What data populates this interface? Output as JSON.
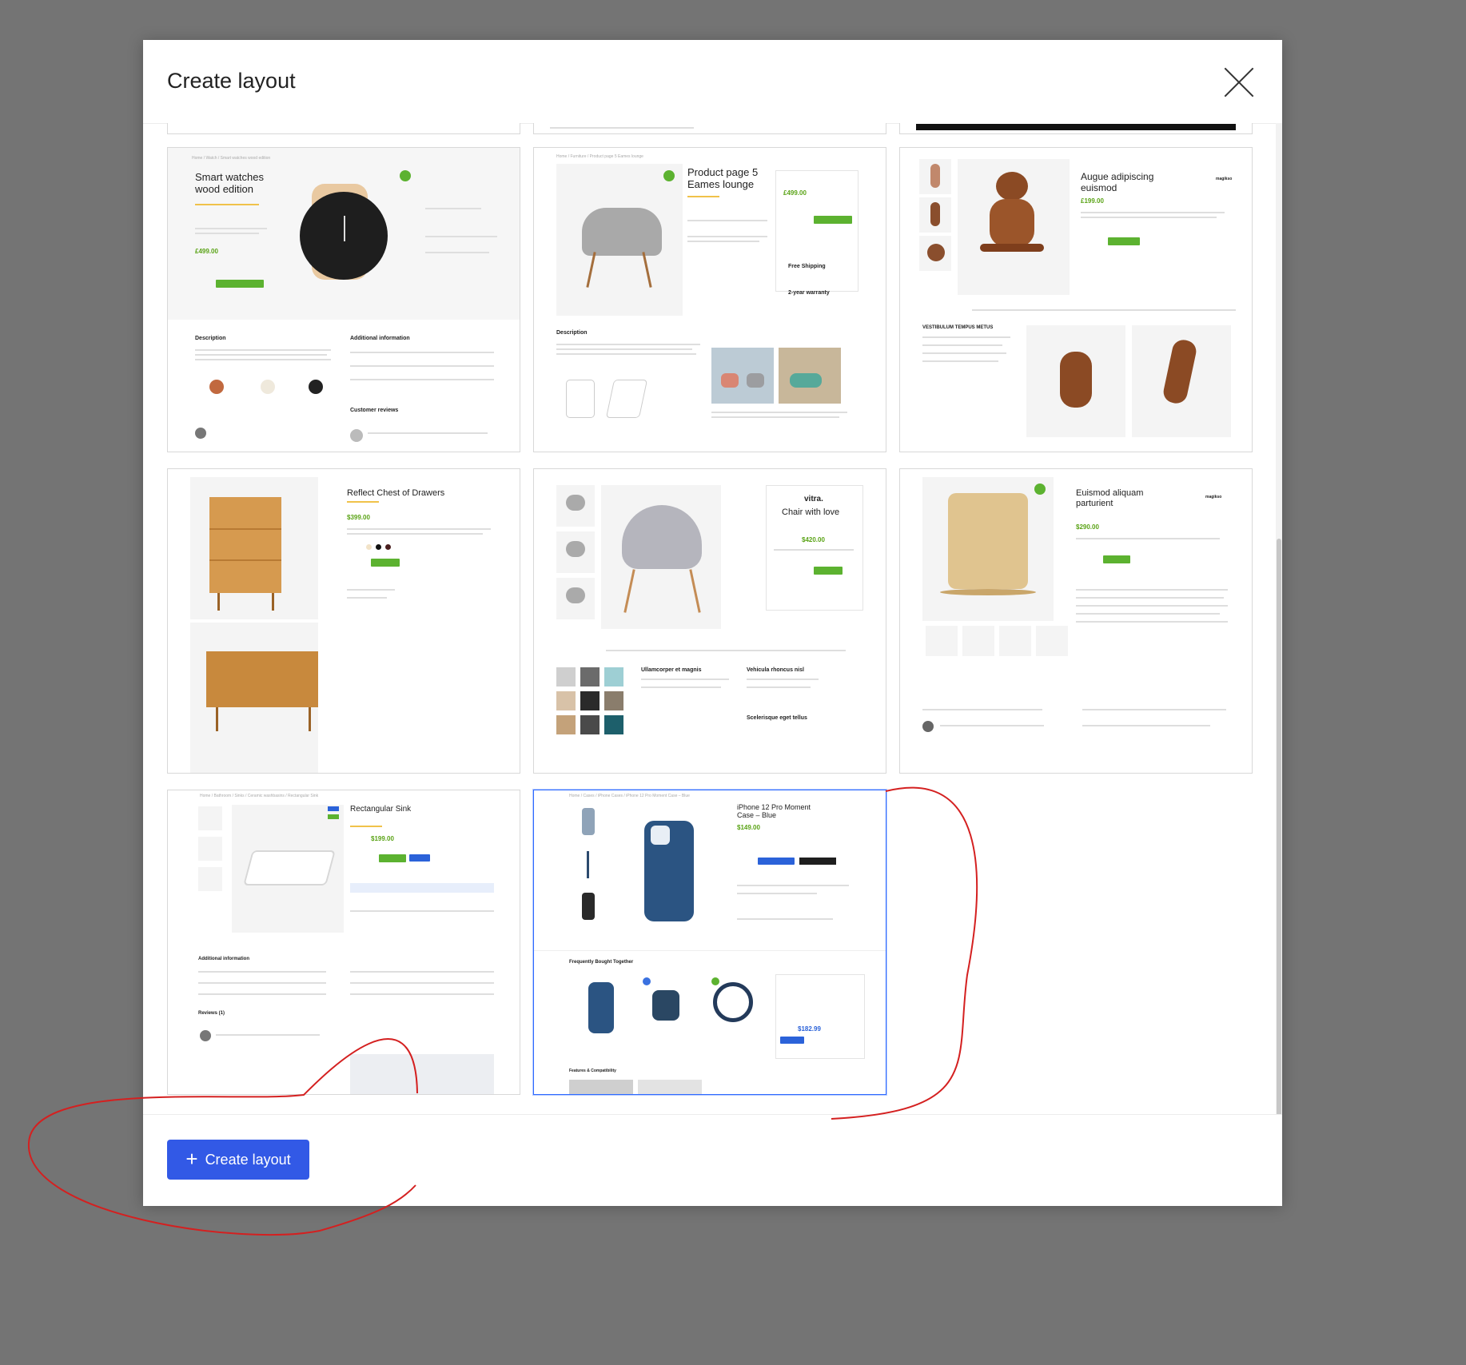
{
  "modal": {
    "title": "Create layout",
    "close_icon": "close-icon",
    "create_button": "Create layout",
    "create_icon": "plus-icon"
  },
  "layouts": [
    {
      "title": "Smart watches\nwood edition",
      "price": "£499.00",
      "sections": [
        "Description",
        "Additional information",
        "Customer reviews"
      ]
    },
    {
      "title": "Product page 5\nEames lounge",
      "price": "£499.00",
      "sections": [
        "Description",
        "Free Shipping",
        "2-year warranty"
      ]
    },
    {
      "title": "Augue adipiscing\neuismod",
      "price": "£199.00",
      "sections": [
        "VESTIBULUM TEMPUS METUS"
      ],
      "brand": "magikso"
    },
    {
      "title": "Reflect Chest of Drawers",
      "price": "$399.00"
    },
    {
      "title": "Chair with love",
      "price": "$420.00",
      "brand": "vitra.",
      "sections": [
        "Ullamcorper et magnis",
        "Vehicula rhoncus nisl",
        "Scelerisque eget tellus"
      ]
    },
    {
      "title": "Euismod aliquam\nparturient",
      "price": "$290.00",
      "brand": "magikso"
    },
    {
      "title": "Rectangular Sink",
      "price": "$199.00",
      "sections": [
        "Additional information",
        "Reviews (1)"
      ]
    },
    {
      "title": "iPhone 12 Pro Moment\nCase – Blue",
      "price": "$149.00",
      "total": "$182.99",
      "sections": [
        "Frequently Bought Together",
        "Features & Compatibility"
      ]
    }
  ],
  "colors": {
    "accent": "#3259e6",
    "selected_border": "#2f6bff",
    "annotation": "#d42020",
    "price_green": "#5aa316"
  }
}
